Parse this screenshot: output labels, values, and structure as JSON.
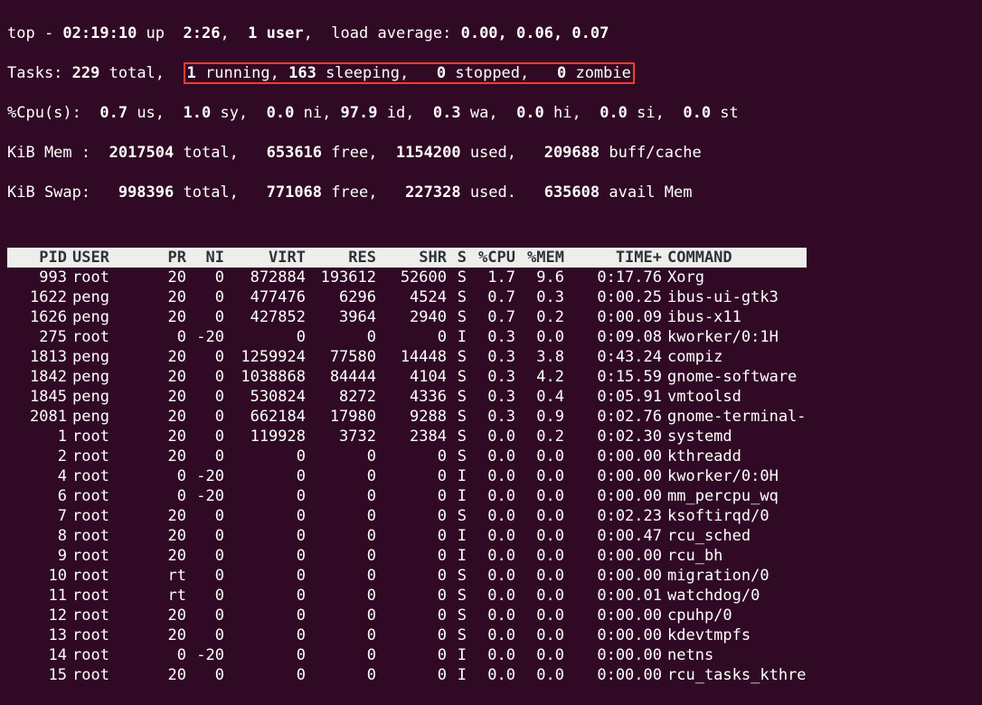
{
  "summary": {
    "line1": {
      "prefix": "top - ",
      "time": "02:19:10",
      "up_label": " up  ",
      "uptime": "2:26",
      "users_sep": ",  ",
      "users": "1 user",
      "load_label": ",  load average: ",
      "load": "0.00, 0.06, 0.07"
    },
    "tasks": {
      "label": "Tasks: ",
      "total": "229",
      "total_word": " total,  ",
      "running": "1",
      "running_word": " running, ",
      "sleeping": "163",
      "sleeping_word": " sleeping,   ",
      "stopped": "0",
      "stopped_word": " stopped,   ",
      "zombie": "0",
      "zombie_word": " zombie"
    },
    "cpu": {
      "label": "%Cpu(s):  ",
      "us": "0.7",
      "us_w": " us,  ",
      "sy": "1.0",
      "sy_w": " sy,  ",
      "ni": "0.0",
      "ni_w": " ni, ",
      "id": "97.9",
      "id_w": " id,  ",
      "wa": "0.3",
      "wa_w": " wa,  ",
      "hi": "0.0",
      "hi_w": " hi,  ",
      "si": "0.0",
      "si_w": " si,  ",
      "st": "0.0",
      "st_w": " st"
    },
    "mem": {
      "label": "KiB Mem :  ",
      "total": "2017504",
      "total_w": " total,   ",
      "free": "653616",
      "free_w": " free,  ",
      "used": "1154200",
      "used_w": " used,   ",
      "buff": "209688",
      "buff_w": " buff/cache"
    },
    "swap": {
      "label": "KiB Swap:   ",
      "total": "998396",
      "total_w": " total,   ",
      "free": "771068",
      "free_w": " free,   ",
      "used": "227328",
      "used_w": " used.   ",
      "avail": "635608",
      "avail_w": " avail Mem"
    }
  },
  "columns": {
    "pid": "PID",
    "user": "USER",
    "pr": "PR",
    "ni": "NI",
    "virt": "VIRT",
    "res": "RES",
    "shr": "SHR",
    "s": "S",
    "cpu": "%CPU",
    "mem": "%MEM",
    "time": "TIME+",
    "cmd": "COMMAND"
  },
  "rows": [
    {
      "pid": "993",
      "user": "root",
      "pr": "20",
      "ni": "0",
      "virt": "872884",
      "res": "193612",
      "shr": "52600",
      "s": "S",
      "cpu": "1.7",
      "mem": "9.6",
      "time": "0:17.76",
      "cmd": "Xorg"
    },
    {
      "pid": "1622",
      "user": "peng",
      "pr": "20",
      "ni": "0",
      "virt": "477476",
      "res": "6296",
      "shr": "4524",
      "s": "S",
      "cpu": "0.7",
      "mem": "0.3",
      "time": "0:00.25",
      "cmd": "ibus-ui-gtk3"
    },
    {
      "pid": "1626",
      "user": "peng",
      "pr": "20",
      "ni": "0",
      "virt": "427852",
      "res": "3964",
      "shr": "2940",
      "s": "S",
      "cpu": "0.7",
      "mem": "0.2",
      "time": "0:00.09",
      "cmd": "ibus-x11"
    },
    {
      "pid": "275",
      "user": "root",
      "pr": "0",
      "ni": "-20",
      "virt": "0",
      "res": "0",
      "shr": "0",
      "s": "I",
      "cpu": "0.3",
      "mem": "0.0",
      "time": "0:09.08",
      "cmd": "kworker/0:1H"
    },
    {
      "pid": "1813",
      "user": "peng",
      "pr": "20",
      "ni": "0",
      "virt": "1259924",
      "res": "77580",
      "shr": "14448",
      "s": "S",
      "cpu": "0.3",
      "mem": "3.8",
      "time": "0:43.24",
      "cmd": "compiz"
    },
    {
      "pid": "1842",
      "user": "peng",
      "pr": "20",
      "ni": "0",
      "virt": "1038868",
      "res": "84444",
      "shr": "4104",
      "s": "S",
      "cpu": "0.3",
      "mem": "4.2",
      "time": "0:15.59",
      "cmd": "gnome-software"
    },
    {
      "pid": "1845",
      "user": "peng",
      "pr": "20",
      "ni": "0",
      "virt": "530824",
      "res": "8272",
      "shr": "4336",
      "s": "S",
      "cpu": "0.3",
      "mem": "0.4",
      "time": "0:05.91",
      "cmd": "vmtoolsd"
    },
    {
      "pid": "2081",
      "user": "peng",
      "pr": "20",
      "ni": "0",
      "virt": "662184",
      "res": "17980",
      "shr": "9288",
      "s": "S",
      "cpu": "0.3",
      "mem": "0.9",
      "time": "0:02.76",
      "cmd": "gnome-terminal-"
    },
    {
      "pid": "1",
      "user": "root",
      "pr": "20",
      "ni": "0",
      "virt": "119928",
      "res": "3732",
      "shr": "2384",
      "s": "S",
      "cpu": "0.0",
      "mem": "0.2",
      "time": "0:02.30",
      "cmd": "systemd"
    },
    {
      "pid": "2",
      "user": "root",
      "pr": "20",
      "ni": "0",
      "virt": "0",
      "res": "0",
      "shr": "0",
      "s": "S",
      "cpu": "0.0",
      "mem": "0.0",
      "time": "0:00.00",
      "cmd": "kthreadd"
    },
    {
      "pid": "4",
      "user": "root",
      "pr": "0",
      "ni": "-20",
      "virt": "0",
      "res": "0",
      "shr": "0",
      "s": "I",
      "cpu": "0.0",
      "mem": "0.0",
      "time": "0:00.00",
      "cmd": "kworker/0:0H"
    },
    {
      "pid": "6",
      "user": "root",
      "pr": "0",
      "ni": "-20",
      "virt": "0",
      "res": "0",
      "shr": "0",
      "s": "I",
      "cpu": "0.0",
      "mem": "0.0",
      "time": "0:00.00",
      "cmd": "mm_percpu_wq"
    },
    {
      "pid": "7",
      "user": "root",
      "pr": "20",
      "ni": "0",
      "virt": "0",
      "res": "0",
      "shr": "0",
      "s": "S",
      "cpu": "0.0",
      "mem": "0.0",
      "time": "0:02.23",
      "cmd": "ksoftirqd/0"
    },
    {
      "pid": "8",
      "user": "root",
      "pr": "20",
      "ni": "0",
      "virt": "0",
      "res": "0",
      "shr": "0",
      "s": "I",
      "cpu": "0.0",
      "mem": "0.0",
      "time": "0:00.47",
      "cmd": "rcu_sched"
    },
    {
      "pid": "9",
      "user": "root",
      "pr": "20",
      "ni": "0",
      "virt": "0",
      "res": "0",
      "shr": "0",
      "s": "I",
      "cpu": "0.0",
      "mem": "0.0",
      "time": "0:00.00",
      "cmd": "rcu_bh"
    },
    {
      "pid": "10",
      "user": "root",
      "pr": "rt",
      "ni": "0",
      "virt": "0",
      "res": "0",
      "shr": "0",
      "s": "S",
      "cpu": "0.0",
      "mem": "0.0",
      "time": "0:00.00",
      "cmd": "migration/0"
    },
    {
      "pid": "11",
      "user": "root",
      "pr": "rt",
      "ni": "0",
      "virt": "0",
      "res": "0",
      "shr": "0",
      "s": "S",
      "cpu": "0.0",
      "mem": "0.0",
      "time": "0:00.01",
      "cmd": "watchdog/0"
    },
    {
      "pid": "12",
      "user": "root",
      "pr": "20",
      "ni": "0",
      "virt": "0",
      "res": "0",
      "shr": "0",
      "s": "S",
      "cpu": "0.0",
      "mem": "0.0",
      "time": "0:00.00",
      "cmd": "cpuhp/0"
    },
    {
      "pid": "13",
      "user": "root",
      "pr": "20",
      "ni": "0",
      "virt": "0",
      "res": "0",
      "shr": "0",
      "s": "S",
      "cpu": "0.0",
      "mem": "0.0",
      "time": "0:00.00",
      "cmd": "kdevtmpfs"
    },
    {
      "pid": "14",
      "user": "root",
      "pr": "0",
      "ni": "-20",
      "virt": "0",
      "res": "0",
      "shr": "0",
      "s": "I",
      "cpu": "0.0",
      "mem": "0.0",
      "time": "0:00.00",
      "cmd": "netns"
    },
    {
      "pid": "15",
      "user": "root",
      "pr": "20",
      "ni": "0",
      "virt": "0",
      "res": "0",
      "shr": "0",
      "s": "I",
      "cpu": "0.0",
      "mem": "0.0",
      "time": "0:00.00",
      "cmd": "rcu_tasks_kthre"
    }
  ]
}
